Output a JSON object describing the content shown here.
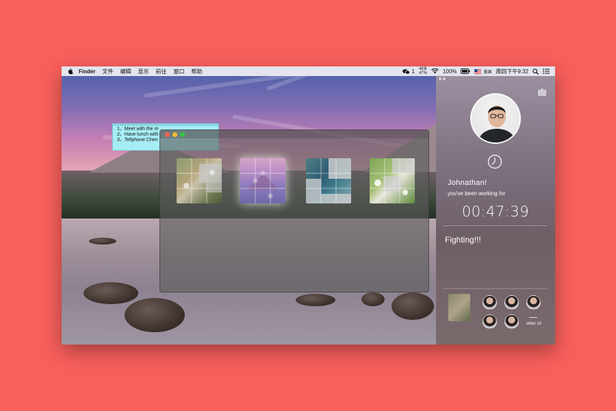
{
  "menubar": {
    "app_name": "Finder",
    "menus": [
      "文件",
      "编辑",
      "显示",
      "前往",
      "窗口",
      "帮助"
    ],
    "status": {
      "net_top": "4KB",
      "net_bottom": "47%",
      "net_left": "1",
      "battery": "100%",
      "input_source": "美国",
      "datetime": "周四下午9:32"
    }
  },
  "sticky": {
    "lines": [
      "1、Meet with the m",
      "2、Have lunch with",
      "3、Tellphone Chen"
    ]
  },
  "puzzles": [
    {
      "name": "puzzle-1"
    },
    {
      "name": "puzzle-2"
    },
    {
      "name": "puzzle-3"
    },
    {
      "name": "puzzle-4"
    }
  ],
  "panel": {
    "username": "Johnathan!",
    "working_label": "you've been working for",
    "timer": "00:47:39",
    "message": "Fighting!!!",
    "other_count": "ohter 10"
  },
  "colors": {
    "background": "#f9605c",
    "close": "#fc5f57",
    "minimize": "#fdbc2e",
    "zoom": "#33c748"
  }
}
